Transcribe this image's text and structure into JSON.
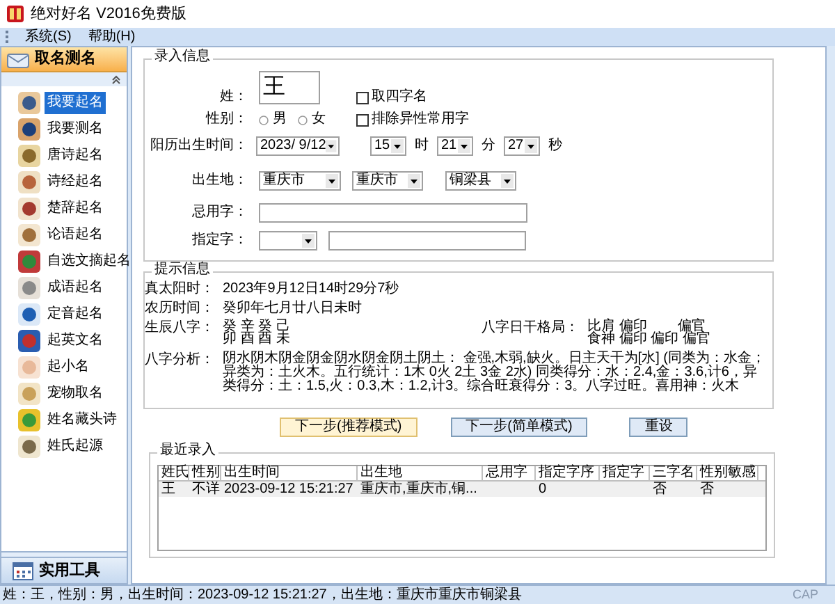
{
  "window": {
    "title": "绝对好名 V2016免费版"
  },
  "menu": [
    {
      "label": "系统(S)"
    },
    {
      "label": "帮助(H)"
    }
  ],
  "sidebar": {
    "header": "取名测名",
    "items": [
      {
        "label": "我要起名",
        "selected": true
      },
      {
        "label": "我要测名",
        "selected": false
      },
      {
        "label": "唐诗起名",
        "selected": false
      },
      {
        "label": "诗经起名",
        "selected": false
      },
      {
        "label": "楚辞起名",
        "selected": false
      },
      {
        "label": "论语起名",
        "selected": false
      },
      {
        "label": "自选文摘起名",
        "selected": false
      },
      {
        "label": "成语起名",
        "selected": false
      },
      {
        "label": "定音起名",
        "selected": false
      },
      {
        "label": "起英文名",
        "selected": false
      },
      {
        "label": "起小名",
        "selected": false
      },
      {
        "label": "宠物取名",
        "selected": false
      },
      {
        "label": "姓名藏头诗",
        "selected": false
      },
      {
        "label": "姓氏起源",
        "selected": false
      }
    ],
    "footer": "实用工具"
  },
  "input_group": {
    "title": "录入信息",
    "surname_label": "姓：",
    "surname": "王",
    "four_char": {
      "label": "取四字名",
      "checked": false
    },
    "gender_label": "性别：",
    "genders": [
      {
        "label": "男",
        "selected": false
      },
      {
        "label": "女",
        "selected": false
      }
    ],
    "exclude": {
      "label": "排除异性常用字",
      "checked": false
    },
    "birth_label": "阳历出生时间：",
    "date": "2023/ 9/12",
    "hour": "15",
    "hour_unit": "时",
    "minute": "21",
    "minute_unit": "分",
    "second": "27",
    "second_unit": "秒",
    "place_label": "出生地：",
    "places": [
      "重庆市",
      "重庆市",
      "铜梁县"
    ],
    "avoid_label": "忌用字：",
    "fixed_label": "指定字："
  },
  "hint_group": {
    "title": "提示信息",
    "solar_label": "真太阳时：",
    "solar": "2023年9月12日14时29分7秒",
    "lunar_label": "农历时间：",
    "lunar": "癸卯年七月廿八日未时",
    "bazi_label": "生辰八字：",
    "bazi": [
      "癸 辛 癸 己",
      "卯 酉 酉 未"
    ],
    "pattern_label": "八字日干格局：",
    "pattern_top": [
      "比肩 偏印",
      "偏官"
    ],
    "pattern_bottom": "食神 偏印 偏印 偏官",
    "analysis_label": "八字分析：",
    "analysis": "阴水阴木阴金阴金阴水阴金阴土阴土： 金强,木弱,缺火。日主天干为[水] (同类为：水金；异类为：土火木。五行统计：1木 0火 2土 3金 2水) 同类得分：水：2.4,金：3.6,计6，异类得分：土：1.5,火：0.3,木：1.2,计3。综合旺衰得分：3。八字过旺。喜用神：火木"
  },
  "buttons": [
    {
      "label": "下一步(推荐模式)",
      "selected": true
    },
    {
      "label": "下一步(简单模式)",
      "selected": false
    },
    {
      "label": "重设",
      "selected": false
    }
  ],
  "recent": {
    "title": "最近录入",
    "columns": [
      "姓氏",
      "性别",
      "出生时间",
      "出生地",
      "忌用字",
      "指定字序",
      "指定字",
      "三字名",
      "性别敏感"
    ],
    "rows": [
      [
        "王",
        "不详",
        "2023-09-12 15:21:27",
        "重庆市,重庆市,铜...",
        null,
        "0",
        null,
        "否",
        "否"
      ]
    ]
  },
  "status_bar": {
    "text": "姓：王，性别：男，出生时间：2023-09-12 15:21:27，出生地：重庆市重庆市铜梁县",
    "indicator": "CAP"
  }
}
